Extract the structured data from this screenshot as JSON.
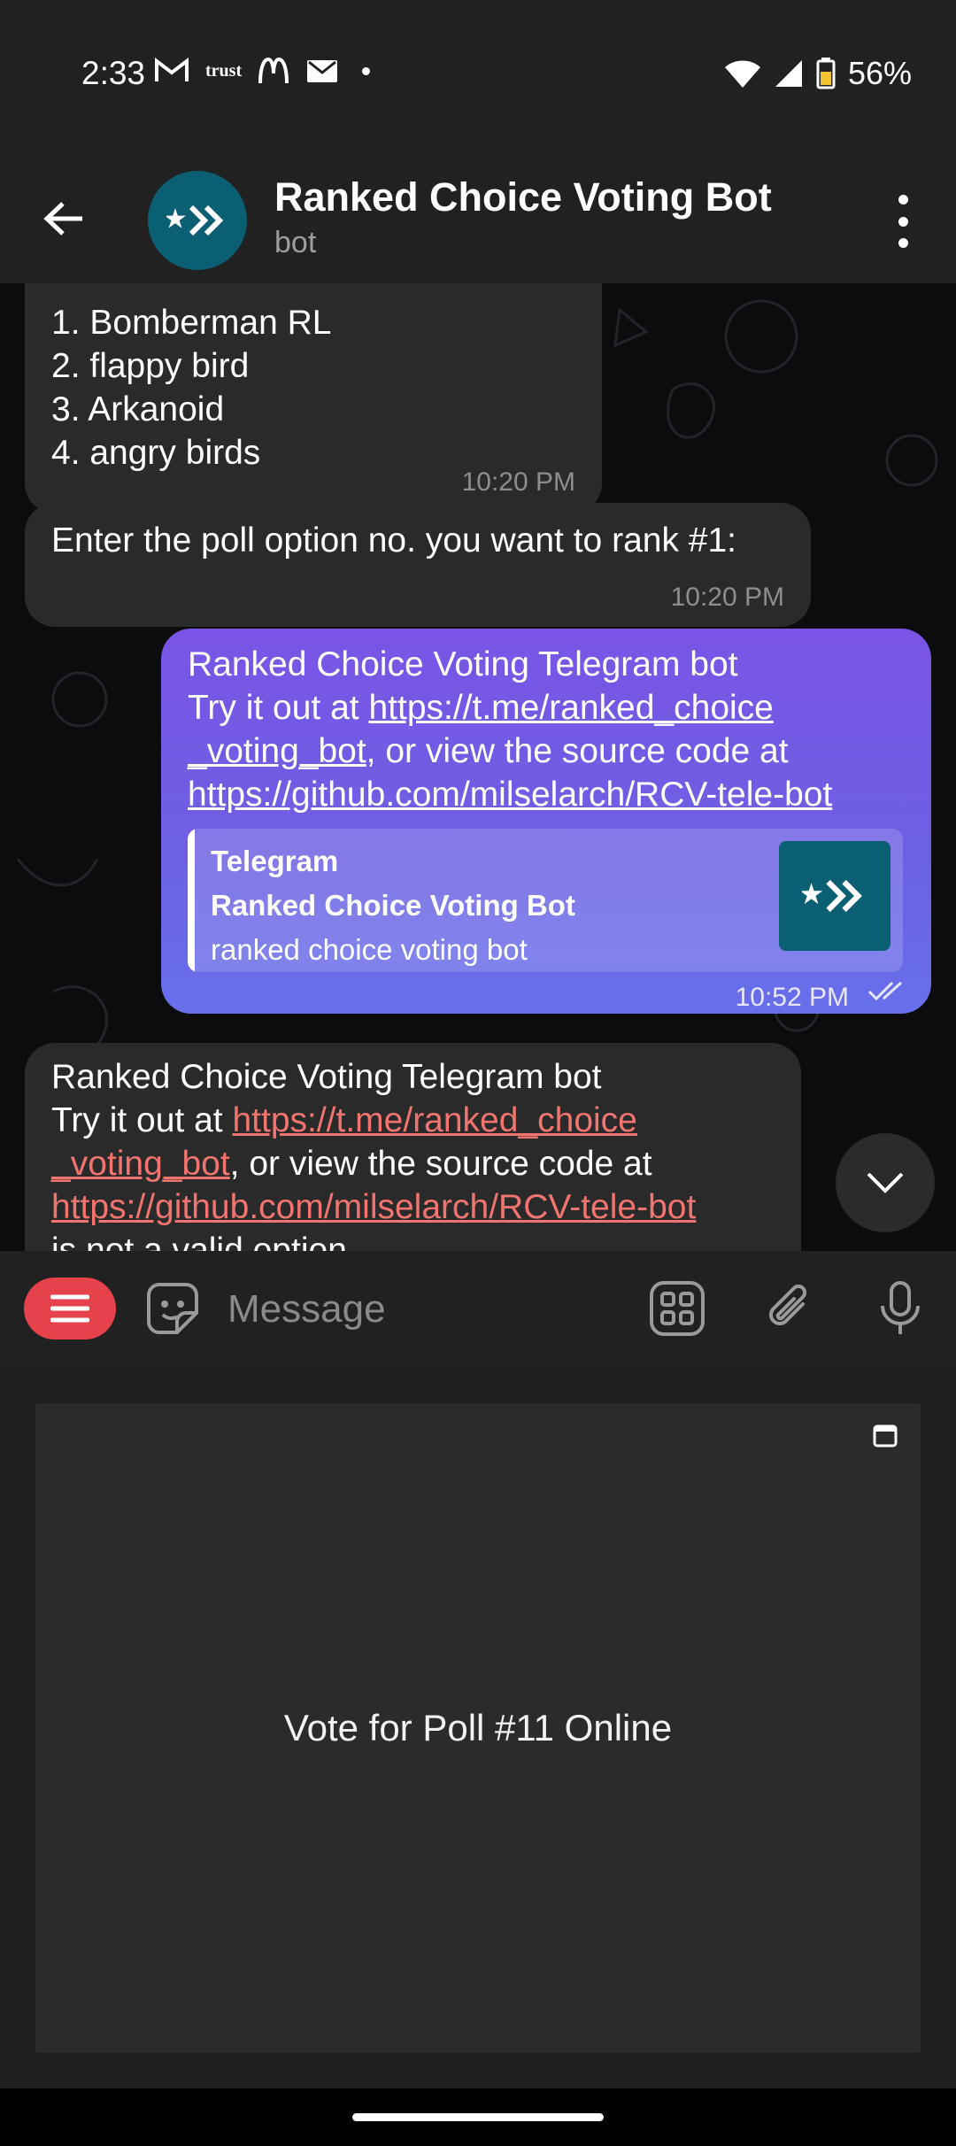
{
  "status_bar": {
    "time": "2:33",
    "left_icons": [
      "gmail-icon",
      "trust-icon",
      "mcdonalds-icon",
      "mail-icon",
      "dot-icon"
    ],
    "trust_label": "trust",
    "battery": "56%"
  },
  "header": {
    "title": "Ranked Choice Voting Bot",
    "subtitle": "bot"
  },
  "messages": {
    "poll_list": {
      "separator": "——————————————————",
      "items": [
        "1. Bomberman RL",
        "2. flappy bird",
        "3. Arkanoid",
        "4. angry birds"
      ],
      "time": "10:20 PM"
    },
    "prompt": {
      "text": "Enter the poll option no. you want to rank #1:",
      "time": "10:20 PM"
    },
    "outgoing": {
      "line1": "Ranked Choice Voting Telegram bot",
      "line2_prefix": "Try it out at ",
      "link1_part1": "https://t.me/ranked_choice",
      "link1_part2": "_voting_bot",
      "line3_suffix": ", or view the source code at",
      "link2": "https://github.com/milselarch/RCV-tele-bot",
      "preview_site": "Telegram",
      "preview_title": "Ranked Choice Voting Bot",
      "preview_desc": "ranked choice voting bot",
      "time": "10:52 PM"
    },
    "reply": {
      "line1": "Ranked Choice Voting Telegram bot",
      "line2_prefix": "Try it out at ",
      "link1_part1": "https://t.me/ranked_choice",
      "link1_part2": "_voting_bot",
      "line3_suffix": ", or view the source code at",
      "link2": "https://github.com/milselarch/RCV-tele-bot",
      "line5": "is not a valid option"
    }
  },
  "input": {
    "placeholder": "Message"
  },
  "keyboard": {
    "webapp_button": "Vote for Poll #11 Online"
  },
  "colors": {
    "outgoing_bubble": "#7a54e6",
    "incoming_bubble": "#2a2a2a",
    "link_incoming": "#f1746f",
    "menu_button": "#e5424b",
    "bot_avatar": "#0b5f73"
  }
}
